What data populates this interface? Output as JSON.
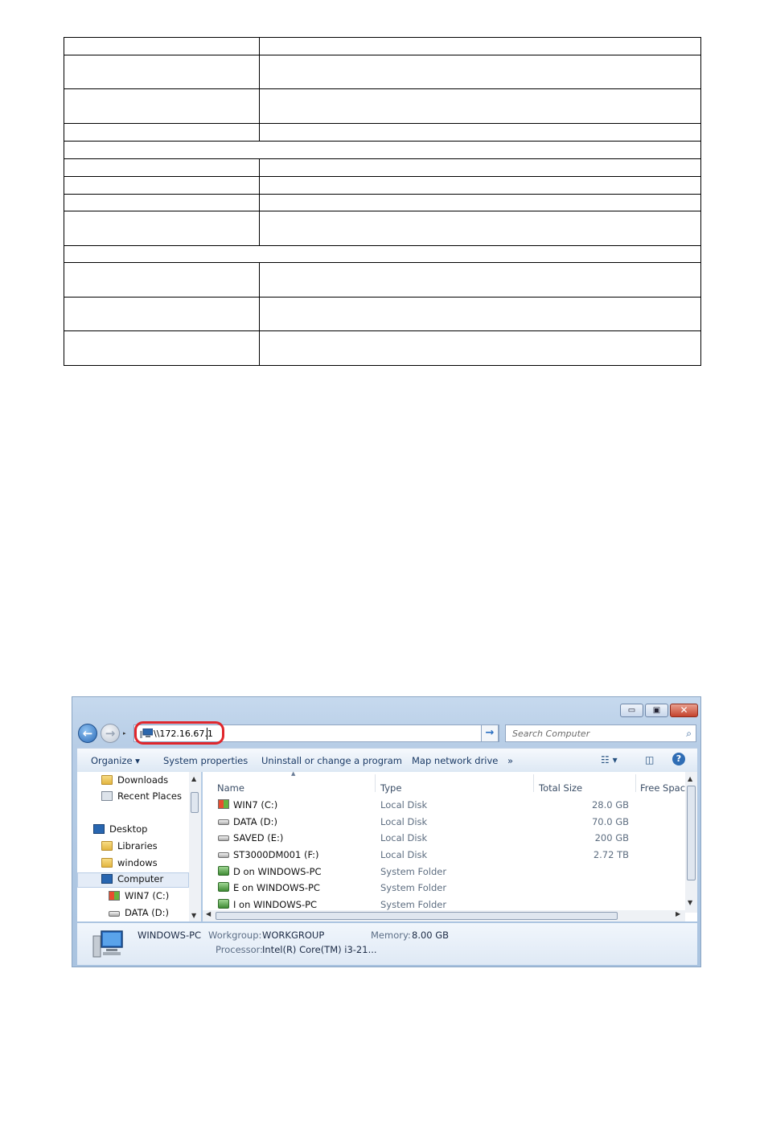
{
  "window": {
    "address": "\\\\172.16.67.1",
    "search_placeholder": "Search Computer",
    "controls": {
      "minimize": "▭",
      "maximize": "▣",
      "close": "✕"
    }
  },
  "toolbar": {
    "organize": "Organize ▾",
    "system_properties": "System properties",
    "uninstall": "Uninstall or change a program",
    "map_drive": "Map network drive",
    "more": "»"
  },
  "nav_tree": [
    {
      "label": "Downloads",
      "icon": "folder-icon"
    },
    {
      "label": "Recent Places",
      "icon": "recent-places-icon"
    },
    {
      "label": "Desktop",
      "icon": "desktop-icon"
    },
    {
      "label": "Libraries",
      "icon": "libraries-icon"
    },
    {
      "label": "windows",
      "icon": "user-folder-icon"
    },
    {
      "label": "Computer",
      "icon": "computer-icon",
      "selected": true
    },
    {
      "label": "WIN7 (C:)",
      "icon": "system-drive-icon"
    },
    {
      "label": "DATA (D:)",
      "icon": "drive-icon"
    }
  ],
  "columns": {
    "name": "Name",
    "type": "Type",
    "total_size": "Total Size",
    "free_space": "Free Space"
  },
  "rows": [
    {
      "name": "WIN7 (C:)",
      "type": "Local Disk",
      "size": "28.0 GB",
      "icon": "system-drive-icon"
    },
    {
      "name": "DATA (D:)",
      "type": "Local Disk",
      "size": "70.0 GB",
      "icon": "drive-icon"
    },
    {
      "name": "SAVED (E:)",
      "type": "Local Disk",
      "size": "200 GB",
      "icon": "drive-icon"
    },
    {
      "name": "ST3000DM001 (F:)",
      "type": "Local Disk",
      "size": "2.72 TB",
      "icon": "drive-icon"
    },
    {
      "name": "D on WINDOWS-PC",
      "type": "System Folder",
      "size": "",
      "icon": "network-drive-icon"
    },
    {
      "name": "E on WINDOWS-PC",
      "type": "System Folder",
      "size": "",
      "icon": "network-drive-icon"
    },
    {
      "name": "I on WINDOWS-PC",
      "type": "System Folder",
      "size": "",
      "icon": "network-drive-icon"
    }
  ],
  "details": {
    "computer_name": "WINDOWS-PC",
    "workgroup_label": "Workgroup:",
    "workgroup_value": "WORKGROUP",
    "memory_label": "Memory:",
    "memory_value": "8.00 GB",
    "processor_label": "Processor:",
    "processor_value": "Intel(R) Core(TM) i3-21..."
  }
}
